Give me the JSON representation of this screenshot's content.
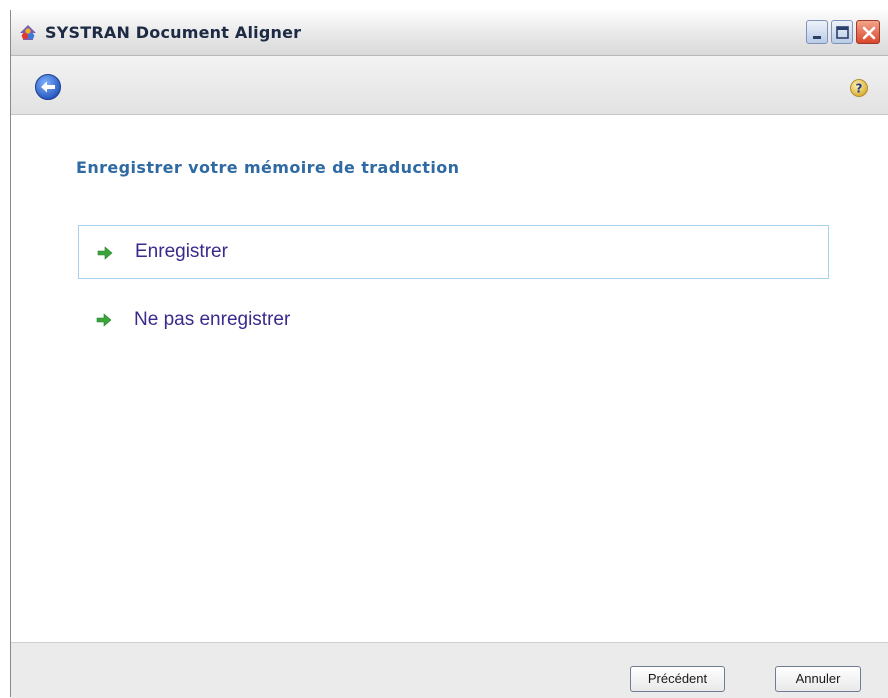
{
  "window": {
    "title": "SYSTRAN Document Aligner",
    "icons": {
      "app": "systran-app-icon",
      "minimize": "minimize-icon",
      "maximize": "maximize-icon",
      "close": "close-icon"
    }
  },
  "toolbar": {
    "back_icon": "back-arrow-icon",
    "help_icon": "help-icon"
  },
  "main": {
    "heading": "Enregistrer votre mémoire de traduction",
    "options": [
      {
        "label": "Enregistrer",
        "icon": "green-arrow-icon",
        "selected": true
      },
      {
        "label": "Ne pas enregistrer",
        "icon": "green-arrow-icon",
        "selected": false
      }
    ]
  },
  "footer": {
    "prev_label": "Précédent",
    "cancel_label": "Annuler"
  },
  "colors": {
    "heading": "#2f6aa3",
    "option_text": "#3b2a8c",
    "selection_border": "#a9d3ec",
    "arrow_green": "#3aa53a",
    "close_red": "#d9462c"
  }
}
